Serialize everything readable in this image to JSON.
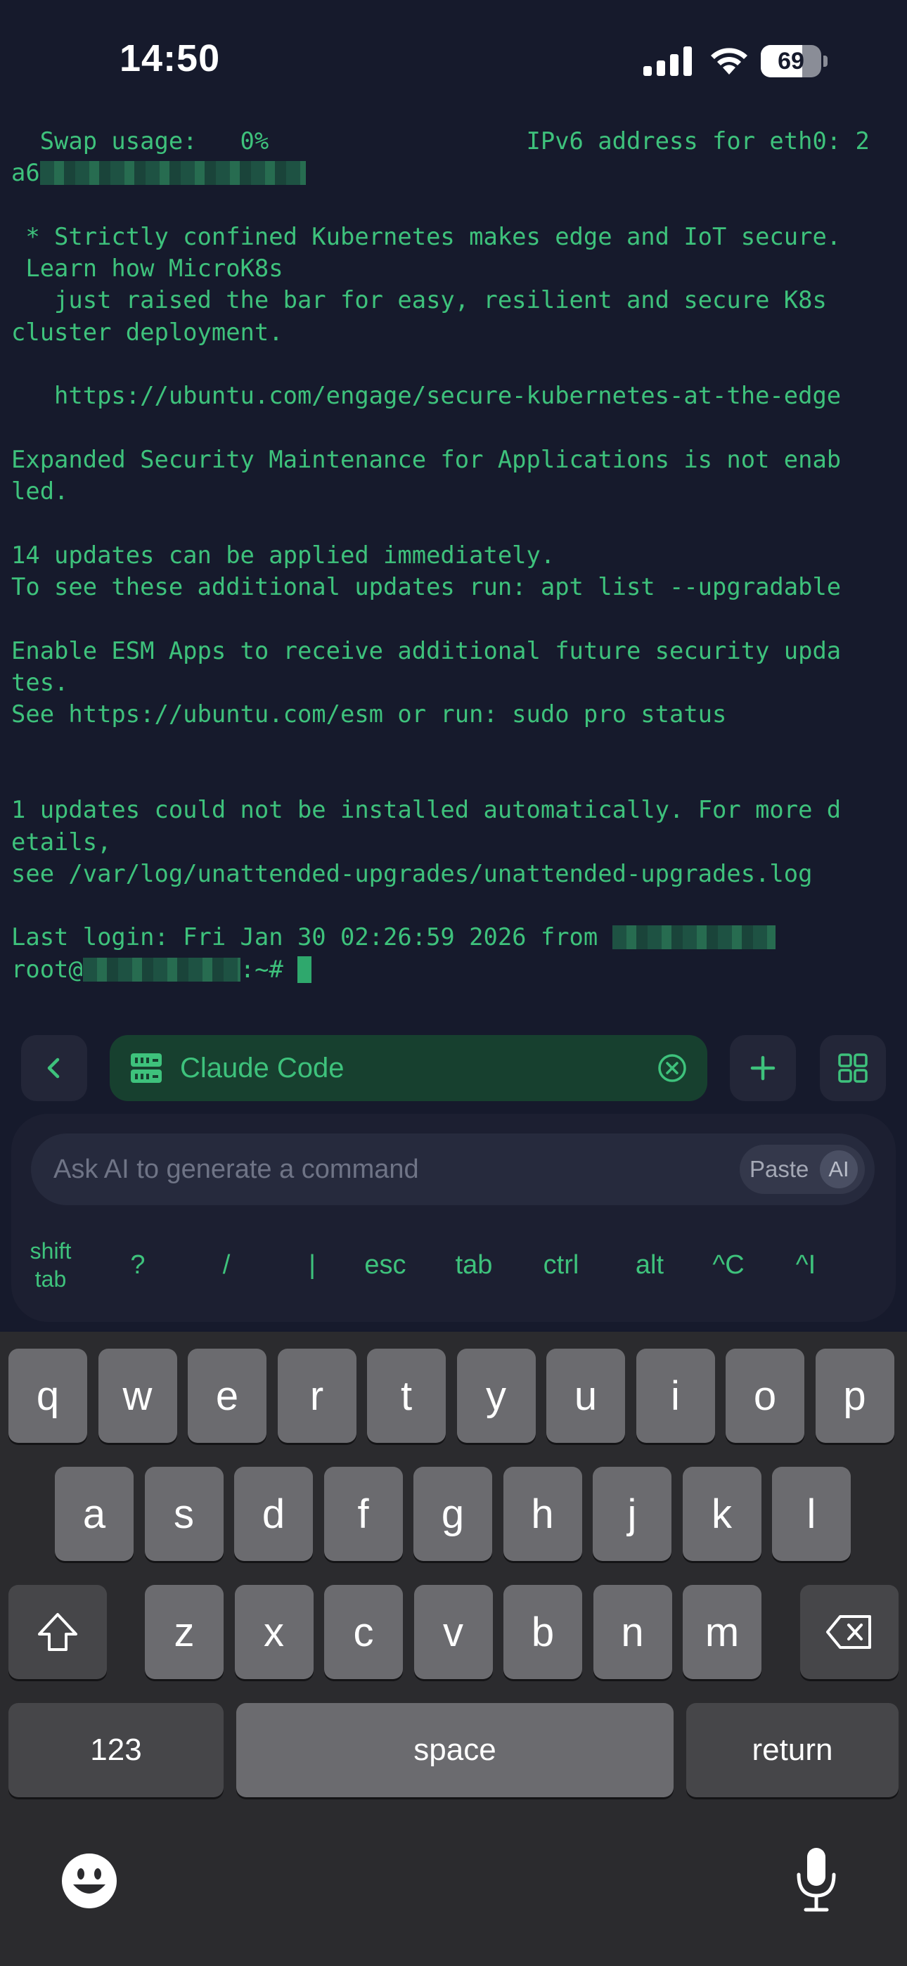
{
  "status_bar": {
    "time": "14:50",
    "battery_level": "69",
    "battery_fraction": 0.69
  },
  "terminal": {
    "lines": [
      "  Swap usage:   0%                  IPv6 address for eth0: 2",
      "a6",
      "",
      " * Strictly confined Kubernetes makes edge and IoT secure.",
      " Learn how MicroK8s",
      "   just raised the bar for easy, resilient and secure K8s",
      "cluster deployment.",
      "",
      "   https://ubuntu.com/engage/secure-kubernetes-at-the-edge",
      "",
      "Expanded Security Maintenance for Applications is not enab",
      "led.",
      "",
      "14 updates can be applied immediately.",
      "To see these additional updates run: apt list --upgradable",
      "",
      "Enable ESM Apps to receive additional future security upda",
      "tes.",
      "See https://ubuntu.com/esm or run: sudo pro status",
      "",
      "",
      "1 updates could not be installed automatically. For more d",
      "etails,",
      "see /var/log/unattended-upgrades/unattended-upgrades.log",
      "",
      "Last login: Fri Jan 30 02:26:59 2026 from "
    ],
    "prompt_user": "root@",
    "prompt_suffix": ":~# "
  },
  "session_bar": {
    "back_icon": "chevron-left-icon",
    "session_name": "Claude Code",
    "session_icon": "server-icon",
    "close_icon": "close-circle-icon",
    "add_icon": "plus-icon",
    "grid_icon": "grid-icon"
  },
  "ai_panel": {
    "placeholder": "Ask AI to generate a command",
    "paste_label": "Paste",
    "ai_label": "AI",
    "shortcut_keys": [
      {
        "line1": "shift",
        "line2": "tab"
      },
      {
        "label": "?"
      },
      {
        "label": "/"
      },
      {
        "label": "|"
      },
      {
        "label": "esc"
      },
      {
        "label": "tab"
      },
      {
        "label": "ctrl"
      },
      {
        "label": "alt"
      },
      {
        "label": "^C"
      },
      {
        "label": "^I"
      }
    ]
  },
  "keyboard": {
    "row1": [
      "q",
      "w",
      "e",
      "r",
      "t",
      "y",
      "u",
      "i",
      "o",
      "p"
    ],
    "row2": [
      "a",
      "s",
      "d",
      "f",
      "g",
      "h",
      "j",
      "k",
      "l"
    ],
    "row3": [
      "z",
      "x",
      "c",
      "v",
      "b",
      "n",
      "m"
    ],
    "numbers_label": "123",
    "space_label": "space",
    "return_label": "return",
    "shift_icon": "shift-icon",
    "backspace_icon": "backspace-icon",
    "emoji_icon": "emoji-icon",
    "mic_icon": "microphone-icon"
  },
  "colors": {
    "background": "#161a2c",
    "terminal_text": "#3ec27c",
    "session_tab_bg": "#17402f",
    "keyboard_bg": "#2b2b2e",
    "key_bg": "#6b6b6f"
  }
}
